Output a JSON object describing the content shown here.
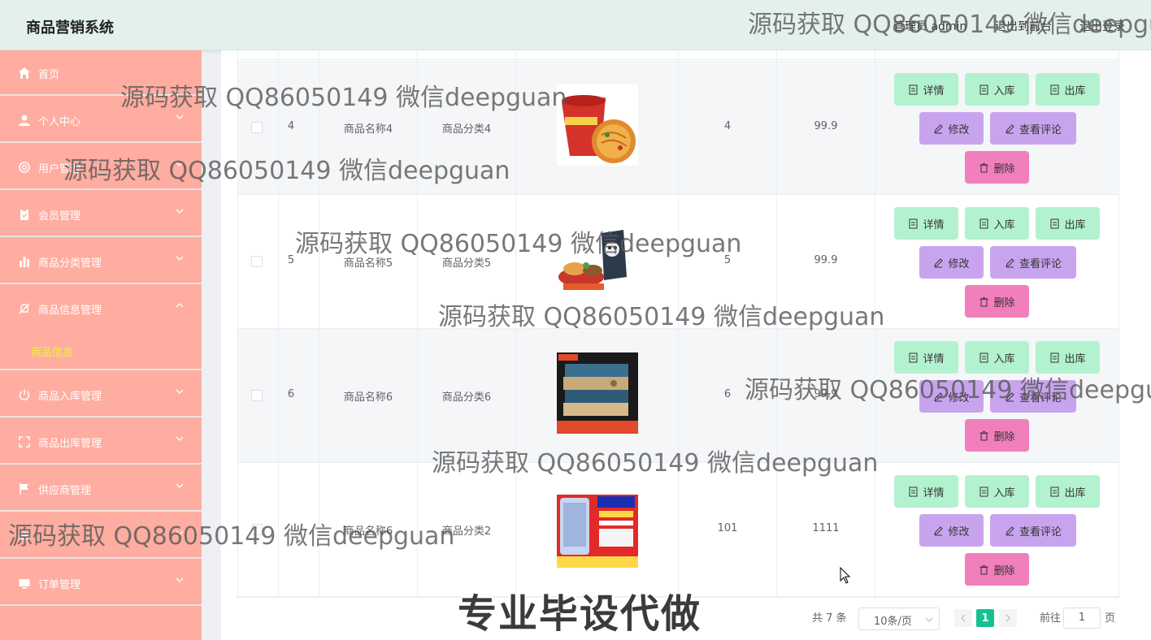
{
  "header": {
    "title": "商品营销系统",
    "admin_label": "管理员 admin",
    "front_link": "退出到前台",
    "logout_link": "退出登录"
  },
  "sidebar": {
    "items": [
      {
        "label": "首页",
        "icon": "home-icon"
      },
      {
        "label": "个人中心",
        "icon": "user-icon"
      },
      {
        "label": "用户管理",
        "icon": "users-icon"
      },
      {
        "label": "会员管理",
        "icon": "clipboard-icon"
      },
      {
        "label": "商品分类管理",
        "icon": "bar-chart-icon"
      },
      {
        "label": "商品信息管理",
        "icon": "bell-off-icon"
      },
      {
        "label": "商品入库管理",
        "icon": "power-icon"
      },
      {
        "label": "商品出库管理",
        "icon": "fullscreen-icon"
      },
      {
        "label": "供应商管理",
        "icon": "flag-icon"
      },
      {
        "label": "",
        "icon": "menu-icon"
      },
      {
        "label": "订单管理",
        "icon": "monitor-icon"
      }
    ],
    "sub_item": "商品信息",
    "expanded_index": 5
  },
  "table": {
    "rows": [
      {
        "id": "4",
        "name": "商品名称4",
        "category": "商品分类4",
        "image": "instant-noodle-bowl",
        "stock": "4",
        "price": "99.9"
      },
      {
        "id": "5",
        "name": "商品名称5",
        "category": "商品分类5",
        "image": "snack-pack",
        "stock": "5",
        "price": "99.9"
      },
      {
        "id": "6",
        "name": "商品名称6",
        "category": "商品分类6",
        "image": "notebook-stack",
        "stock": "6",
        "price": "99.9"
      },
      {
        "id": "",
        "name": "商品名称6",
        "category": "商品分类2",
        "image": "smartphone-ad",
        "stock": "101",
        "price": "1111"
      }
    ],
    "actions": {
      "detail": "详情",
      "stock_in": "入库",
      "stock_out": "出库",
      "edit": "修改",
      "comments": "查看评论",
      "delete": "删除"
    }
  },
  "pagination": {
    "total": "共 7 条",
    "page_size": "10条/页",
    "current_page": "1",
    "goto_label": "前往",
    "goto_value": "1",
    "page_unit": "页"
  },
  "overlays": {
    "watermark": "源码获取 QQ86050149 微信deepguan",
    "promo": "专业毕设代做"
  },
  "colors": {
    "header_bg": "#e4f1ea",
    "sidebar_bg": "#ffada0",
    "submenu_active": "#f3f03a",
    "btn_green": "#b3f2cf",
    "btn_purple": "#c9a4ee",
    "btn_pink": "#f07fbb",
    "page_active": "#14c291"
  }
}
